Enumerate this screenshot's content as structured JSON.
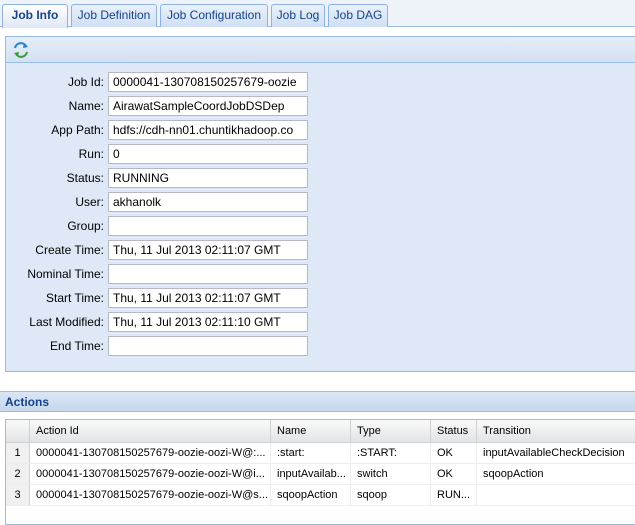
{
  "tabs": [
    {
      "label": "Job Info",
      "active": true
    },
    {
      "label": "Job Definition",
      "active": false
    },
    {
      "label": "Job Configuration",
      "active": false
    },
    {
      "label": "Job Log",
      "active": false
    },
    {
      "label": "Job DAG",
      "active": false
    }
  ],
  "toolbar": {
    "refresh_icon": "refresh-icon"
  },
  "fields": {
    "job_id": {
      "label": "Job Id:",
      "value": "0000041-130708150257679-oozie"
    },
    "name": {
      "label": "Name:",
      "value": "AirawatSampleCoordJobDSDep"
    },
    "app_path": {
      "label": "App Path:",
      "value": "hdfs://cdh-nn01.chuntikhadoop.co"
    },
    "run": {
      "label": "Run:",
      "value": "0"
    },
    "status": {
      "label": "Status:",
      "value": "RUNNING"
    },
    "user": {
      "label": "User:",
      "value": "akhanolk"
    },
    "group": {
      "label": "Group:",
      "value": ""
    },
    "create_time": {
      "label": "Create Time:",
      "value": "Thu, 11 Jul 2013 02:11:07 GMT"
    },
    "nominal_time": {
      "label": "Nominal Time:",
      "value": ""
    },
    "start_time": {
      "label": "Start Time:",
      "value": "Thu, 11 Jul 2013 02:11:07 GMT"
    },
    "last_modified": {
      "label": "Last Modified:",
      "value": "Thu, 11 Jul 2013 02:11:10 GMT"
    },
    "end_time": {
      "label": "End Time:",
      "value": ""
    }
  },
  "actions": {
    "title": "Actions",
    "columns": [
      "Action Id",
      "Name",
      "Type",
      "Status",
      "Transition"
    ],
    "rows": [
      {
        "num": "1",
        "action_id": "0000041-130708150257679-oozie-oozi-W@:...",
        "name": ":start:",
        "type": ":START:",
        "status": "OK",
        "transition": "inputAvailableCheckDecision"
      },
      {
        "num": "2",
        "action_id": "0000041-130708150257679-oozie-oozi-W@i...",
        "name": "inputAvailab...",
        "type": "switch",
        "status": "OK",
        "transition": "sqoopAction"
      },
      {
        "num": "3",
        "action_id": "0000041-130708150257679-oozie-oozi-W@s...",
        "name": "sqoopAction",
        "type": "sqoop",
        "status": "RUN...",
        "transition": ""
      }
    ]
  }
}
